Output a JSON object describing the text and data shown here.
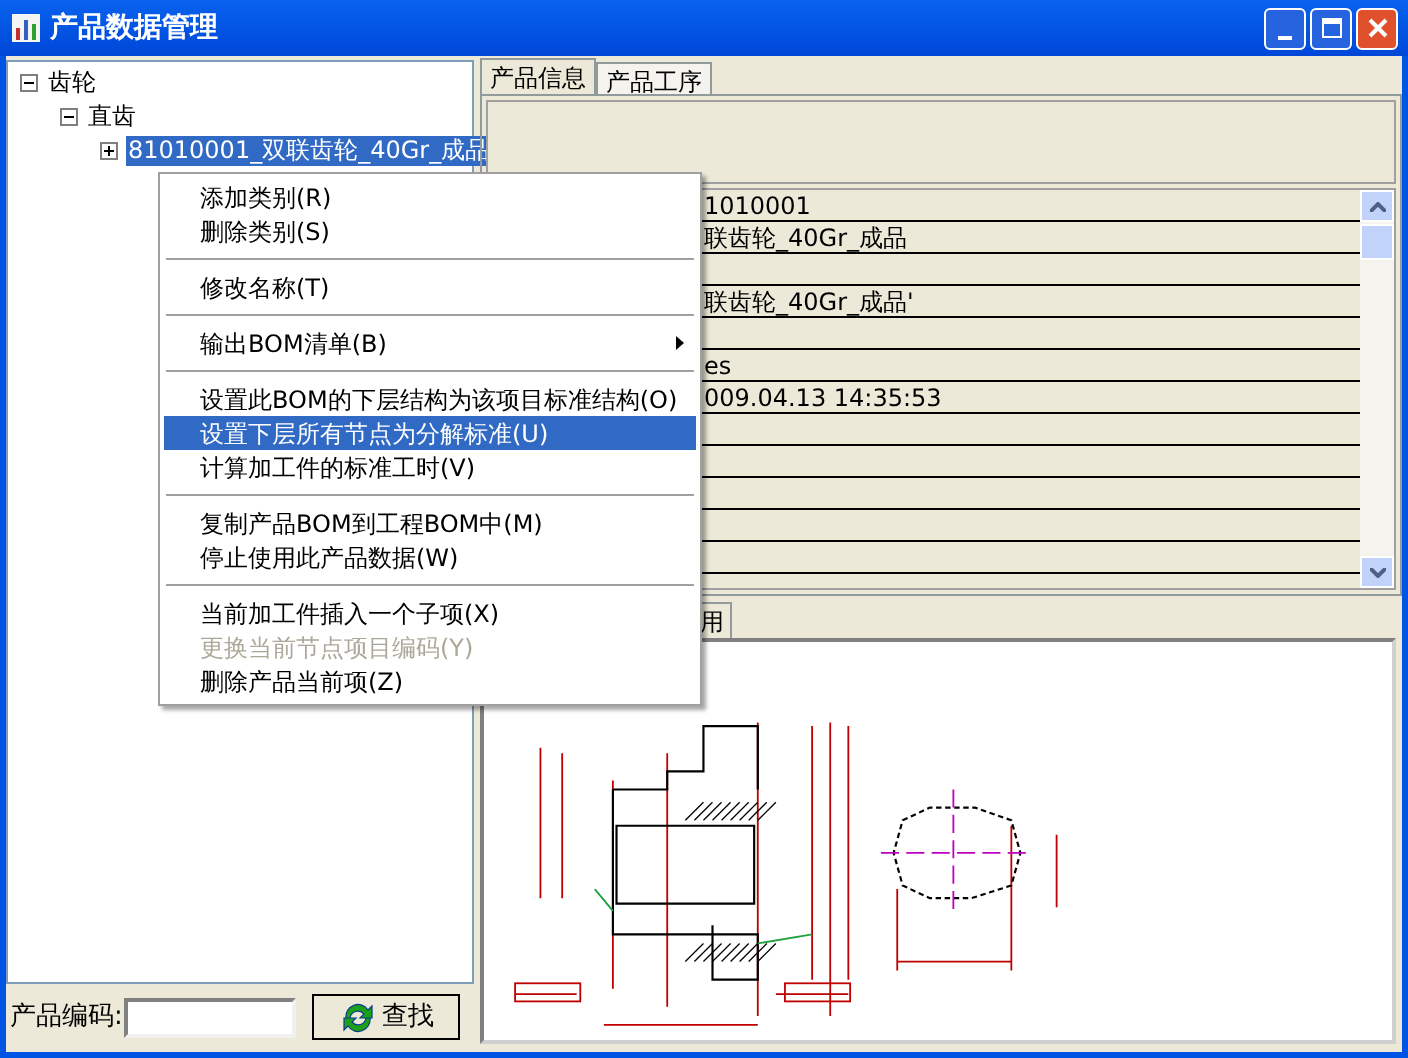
{
  "window": {
    "title": "产品数据管理"
  },
  "tree": [
    {
      "label": "齿轮",
      "expanded": true,
      "selected": false,
      "children": [
        {
          "label": "直齿",
          "expanded": true,
          "selected": false,
          "children": [
            {
              "label": "81010001_双联齿轮_40Gr_成品",
              "expanded": false,
              "selected": true
            }
          ]
        }
      ]
    }
  ],
  "search": {
    "label": "产品编码:",
    "button": "查找"
  },
  "tabs": [
    {
      "label": "产品信息",
      "selected": true
    },
    {
      "label": "产品工序",
      "selected": false
    }
  ],
  "grid": {
    "rows": [
      {
        "value": "1010001"
      },
      {
        "value": "联齿轮_40Gr_成品"
      },
      {},
      {
        "value": "联齿轮_40Gr_成品'"
      },
      {},
      {
        "value": "es"
      },
      {
        "value": "009.04.13 14:35:53"
      },
      {},
      {},
      {},
      {},
      {}
    ]
  },
  "lower_tabs": [
    {
      "label": "用",
      "selected": true
    }
  ],
  "context_menu": [
    {
      "kind": "item",
      "label": "添加类别(R)",
      "selected": false,
      "disabled": false,
      "submenu": false
    },
    {
      "kind": "item",
      "label": "删除类别(S)",
      "selected": false,
      "disabled": false,
      "submenu": false
    },
    {
      "kind": "separator"
    },
    {
      "kind": "item",
      "label": "修改名称(T)",
      "selected": false,
      "disabled": false,
      "submenu": false
    },
    {
      "kind": "separator"
    },
    {
      "kind": "item",
      "label": "输出BOM清单(B)",
      "selected": false,
      "disabled": false,
      "submenu": true
    },
    {
      "kind": "separator"
    },
    {
      "kind": "item",
      "label": "设置此BOM的下层结构为该项目标准结构(O)",
      "selected": false,
      "disabled": false,
      "submenu": false
    },
    {
      "kind": "item",
      "label": "设置下层所有节点为分解标准(U)",
      "selected": true,
      "disabled": false,
      "submenu": false
    },
    {
      "kind": "item",
      "label": "计算加工件的标准工时(V)",
      "selected": false,
      "disabled": false,
      "submenu": false
    },
    {
      "kind": "separator"
    },
    {
      "kind": "item",
      "label": "复制产品BOM到工程BOM中(M)",
      "selected": false,
      "disabled": false,
      "submenu": false
    },
    {
      "kind": "item",
      "label": "停止使用此产品数据(W)",
      "selected": false,
      "disabled": false,
      "submenu": false
    },
    {
      "kind": "separator"
    },
    {
      "kind": "item",
      "label": "当前加工件插入一个子项(X)",
      "selected": false,
      "disabled": false,
      "submenu": false
    },
    {
      "kind": "item",
      "label": "更换当前节点项目编码(Y)",
      "selected": false,
      "disabled": true,
      "submenu": false
    },
    {
      "kind": "item",
      "label": "删除产品当前项(Z)",
      "selected": false,
      "disabled": false,
      "submenu": false
    }
  ]
}
